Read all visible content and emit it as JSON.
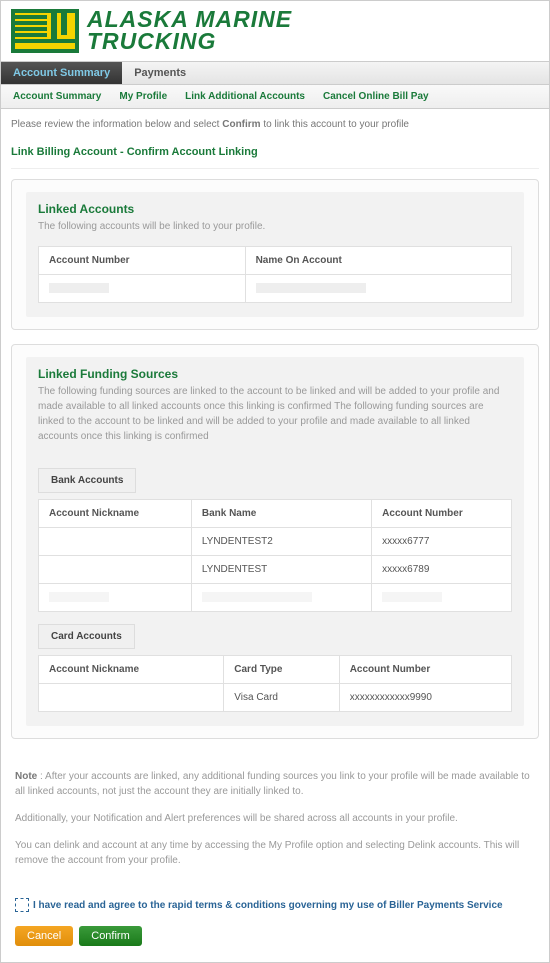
{
  "brand": {
    "line1": "ALASKA MARINE",
    "line2": "TRUCKING"
  },
  "mainTabs": {
    "active": "Account Summary",
    "other": "Payments"
  },
  "subNav": [
    "Account Summary",
    "My Profile",
    "Link Additional Accounts",
    "Cancel Online Bill Pay"
  ],
  "instruction_pre": "Please review the information below and select ",
  "instruction_bold": "Confirm",
  "instruction_post": " to link this account to your profile",
  "pageTitle": "Link Billing Account - Confirm Account Linking",
  "linkedAccounts": {
    "heading": "Linked Accounts",
    "desc": "The following accounts will be linked to your profile.",
    "cols": {
      "acct": "Account Number",
      "name": "Name On Account"
    }
  },
  "fundingSources": {
    "heading": "Linked Funding Sources",
    "desc": "The following funding sources are linked to the account to be linked and will be added to your profile and made available to all linked accounts once this linking is confirmed The following funding sources are linked to the account to be linked and will be added to your profile and made available to all linked accounts once this linking is confirmed",
    "bankTab": "Bank Accounts",
    "bankCols": {
      "nick": "Account Nickname",
      "bank": "Bank Name",
      "acct": "Account Number"
    },
    "bankRows": [
      {
        "nick": "",
        "bank": "LYNDENTEST2",
        "acct": "xxxxx6777"
      },
      {
        "nick": "",
        "bank": "LYNDENTEST",
        "acct": "xxxxx6789"
      },
      {
        "nick": "",
        "bank": "",
        "acct": ""
      }
    ],
    "cardTab": "Card Accounts",
    "cardCols": {
      "nick": "Account Nickname",
      "type": "Card Type",
      "acct": "Account Number"
    },
    "cardRows": [
      {
        "nick": "",
        "type": "Visa Card",
        "acct": "xxxxxxxxxxxx9990"
      }
    ]
  },
  "notes": {
    "p1_label": "Note",
    "p1": " : After your accounts are linked, any additional funding sources you link to your profile will be made available to all linked accounts, not just the account they are initially linked to.",
    "p2": "Additionally, your Notification and Alert preferences will be shared across all accounts in your profile.",
    "p3": "You can delink and account at any time by accessing the My Profile option and selecting Delink accounts. This will remove the account from your profile."
  },
  "agree": "I have read and agree to the rapid terms & conditions governing my use of Biller Payments Service",
  "buttons": {
    "cancel": "Cancel",
    "confirm": "Confirm"
  }
}
